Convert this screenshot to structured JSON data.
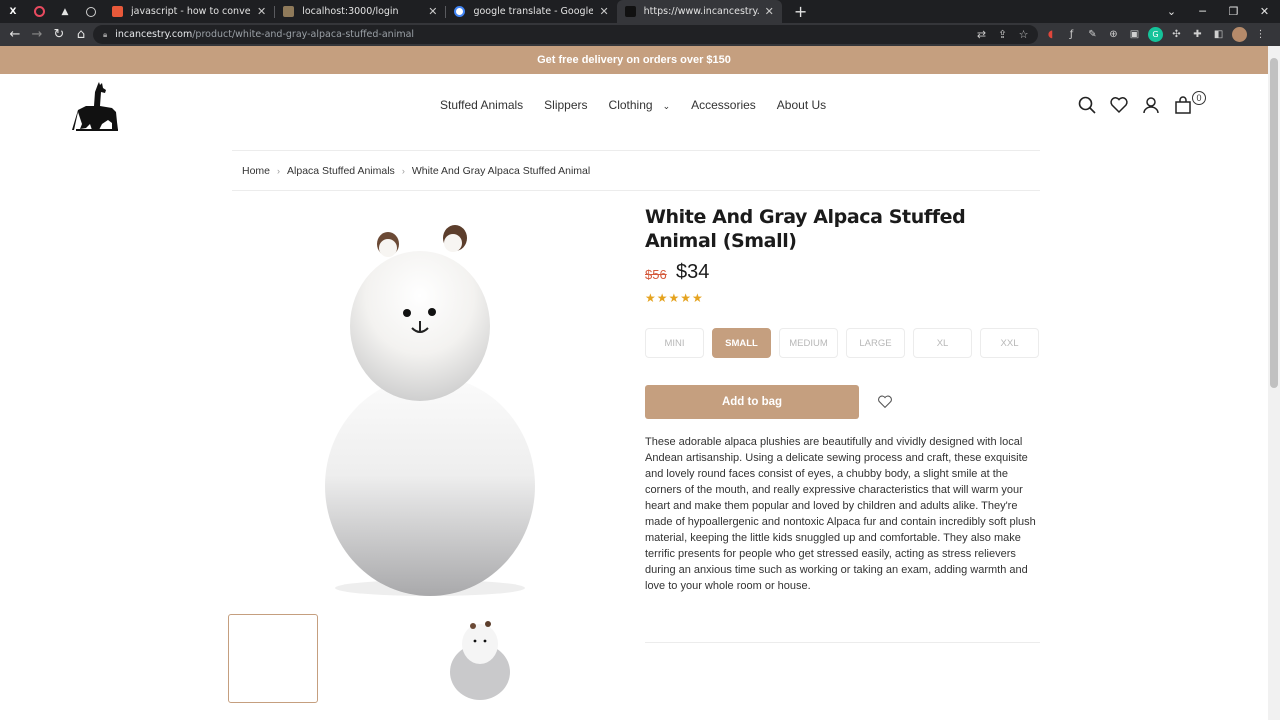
{
  "browser": {
    "tabs": [
      {
        "title": "javascript - how to convert a file",
        "favicon_color": "#e8593a"
      },
      {
        "title": "localhost:3000/login",
        "favicon_color": "#8f7a5a"
      },
      {
        "title": "google translate - Google Search",
        "favicon_color": "#4285f4"
      },
      {
        "title": "https://www.incancestry.com/pr",
        "favicon_color": "#111111",
        "active": true
      }
    ],
    "new_tab": "+",
    "url_host": "incancestry.com",
    "url_path": "/product/white-and-gray-alpaca-stuffed-animal"
  },
  "promo": {
    "text": "Get free delivery on orders over $150"
  },
  "nav": {
    "items": [
      "Stuffed Animals",
      "Slippers",
      "Clothing",
      "Accessories",
      "About Us"
    ],
    "bag_count": "0"
  },
  "breadcrumb": [
    "Home",
    "Alpaca Stuffed Animals",
    "White And Gray Alpaca Stuffed Animal"
  ],
  "product": {
    "title": "White And Gray Alpaca Stuffed Animal (Small)",
    "old_price": "$56",
    "price": "$34",
    "rating": 5,
    "stars": "★★★★★",
    "sizes": [
      "MINI",
      "SMALL",
      "MEDIUM",
      "LARGE",
      "XL",
      "XXL"
    ],
    "selected_size": "SMALL",
    "add_to_bag": "Add to bag",
    "description": "These adorable alpaca plushies are beautifully and vividly designed with local Andean artisanship. Using a delicate sewing process and craft, these exquisite and lovely round faces consist of eyes, a chubby body, a slight smile at the corners of the mouth, and really expressive characteristics that will warm your heart and make them popular and loved by children and adults alike. They're made of hypoallergenic and nontoxic Alpaca fur and contain incredibly soft plush material, keeping the little kids snuggled up and comfortable. They also make terrific presents for people who get stressed easily, acting as stress relievers during an anxious time such as working or taking an exam, adding warmth and love to your whole room or house."
  },
  "colors": {
    "accent": "#c59f7f",
    "old_price": "#d4593b",
    "stars": "#e5a31f"
  }
}
